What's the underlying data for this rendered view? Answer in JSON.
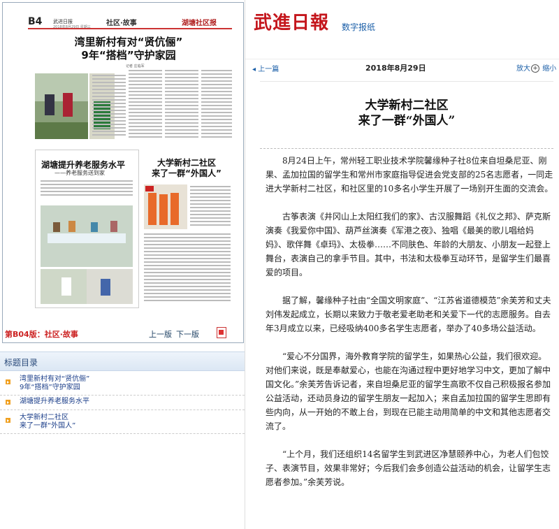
{
  "thumbnail": {
    "page_num": "B4",
    "masthead": "武进日报",
    "masthead_small": "2018年8月29日 星期三",
    "section": "社区·故事",
    "right_label": "湖塘社区报",
    "headline1": "湾里新村有对“贤伉俪”\n9年“搭档”守护家园",
    "byline": "记者 庄临军",
    "headline2": "湖塘提升养老服务水平",
    "headline2_sub": "——养老服务送到家",
    "headline3": "大学新村二社区\n来了一群“外国人”",
    "footer_label": "第B04版：社区·故事",
    "prev_page": "上一版",
    "next_page": "下一版"
  },
  "toc": {
    "title": "标题目录",
    "items": [
      {
        "label": "湾里新村有对“贤伉俪”\n9年“搭档”守护家园"
      },
      {
        "label": "湖塘提升养老服务水平"
      },
      {
        "label": "大学新村二社区\n来了一群“外国人”"
      }
    ]
  },
  "header": {
    "logo": "武進日報",
    "subtitle": "数字报纸"
  },
  "nav": {
    "prev": "◂ 上一篇",
    "date": "2018年8月29日",
    "zoom_in": "放大",
    "zoom_out": "缩小"
  },
  "article": {
    "title": "大学新村二社区\n来了一群“外国人”",
    "paragraphs": [
      "8月24日上午，常州轻工职业技术学院馨缘种子社8位来自坦桑尼亚、刚果、孟加拉国的留学生和常州市家庭指导促进会党支部的25名志愿者，一同走进大学新村二社区，和社区里的10多名小学生开展了一场别开生面的交流会。",
      "古筝表演《井冈山上太阳红我们的家》、古汉服舞蹈《礼仪之邦》、萨克斯演奏《我爱你中国》、葫芦丝演奏《军港之夜》、独唱《最美的歌儿唱给妈妈》、歌伴舞《卓玛》、太极拳……不同肤色、年龄的大朋友、小朋友一起登上舞台，表演自己的拿手节目。其中，书法和太极拳互动环节，是留学生们最喜爱的项目。",
      "据了解，馨缘种子社由“全国文明家庭”、“江苏省道德模范”余芙芳和丈夫刘伟发起成立，长期以来致力于敬老爱老助老和关爱下一代的志愿服务。自去年3月成立以来，已经吸纳400多名学生志愿者，举办了40多场公益活动。",
      "“爱心不分国界，海外教育学院的留学生，如果热心公益，我们很欢迎。对他们来说，既是奉献爱心，也能在沟通过程中更好地学习中文，更加了解中国文化。”余芙芳告诉记者，来自坦桑尼亚的留学生高歌不仅自己积极报名参加公益活动，还动员身边的留学生朋友一起加入；来自孟加拉国的留学生思即有些内向，从一开始的不敢上台，到现在已能主动用简单的中文和其他志愿者交流了。",
      "“上个月，我们还组织14名留学生到武进区净慧颐养中心，为老人们包饺子、表演节目，效果非常好；今后我们会多创造公益活动的机会，让留学生志愿者参加。”余芙芳说。"
    ]
  }
}
